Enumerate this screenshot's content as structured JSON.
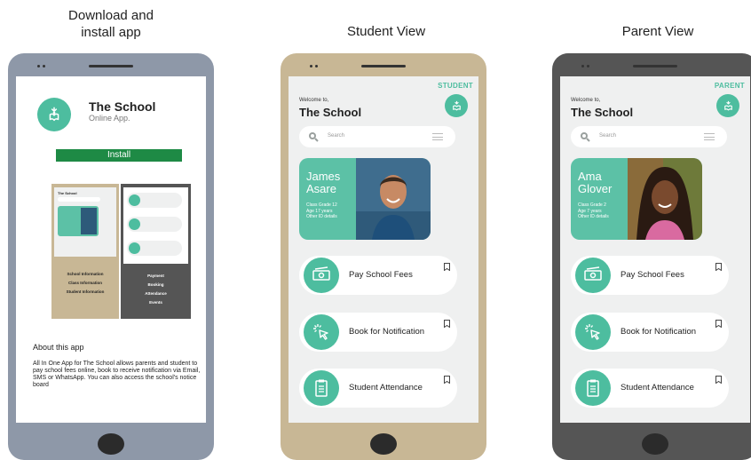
{
  "captions": {
    "download_line1": "Download and",
    "download_line2": "install app",
    "student": "Student View",
    "parent": "Parent View"
  },
  "colors": {
    "accent": "#4dbd9f",
    "install_button": "#1e8a45",
    "phone_download": "#8e98a8",
    "phone_student": "#c8b795",
    "phone_parent": "#555555"
  },
  "download_screen": {
    "app_name": "The School",
    "app_subtitle": "Online App.",
    "install_label": "Install",
    "preview_left_links": [
      "School Information",
      "Class Information",
      "Student Information"
    ],
    "preview_right_links": [
      "Payment",
      "Booking",
      "Attendance",
      "Events"
    ],
    "about_title": "About this app",
    "about_text": "All In One App for The School allows parents and student to pay school fees online, book to receive notification via Email, SMS or WhatsApp. You can also access the school's notice board"
  },
  "student_screen": {
    "role": "STUDENT",
    "welcome": "Welcome to,",
    "title": "The School",
    "search_placeholder": "Search",
    "card": {
      "name": "James Asare",
      "line1": "Class Grade 12",
      "line2": "Age 17 years",
      "line3": "Other ID details"
    },
    "actions": [
      {
        "label": "Pay School Fees",
        "icon": "money-icon"
      },
      {
        "label": "Book for Notification",
        "icon": "click-icon"
      },
      {
        "label": "Student Attendance",
        "icon": "clipboard-icon"
      }
    ]
  },
  "parent_screen": {
    "role": "PARENT",
    "welcome": "Welcome to,",
    "title": "The School",
    "search_placeholder": "Search",
    "card": {
      "name": "Ama Glover",
      "line1": "Class Grade 2",
      "line2": "Age 7 years",
      "line3": "Other ID details"
    },
    "actions": [
      {
        "label": "Pay School Fees",
        "icon": "money-icon"
      },
      {
        "label": "Book for Notification",
        "icon": "click-icon"
      },
      {
        "label": "Student Attendance",
        "icon": "clipboard-icon"
      }
    ]
  }
}
